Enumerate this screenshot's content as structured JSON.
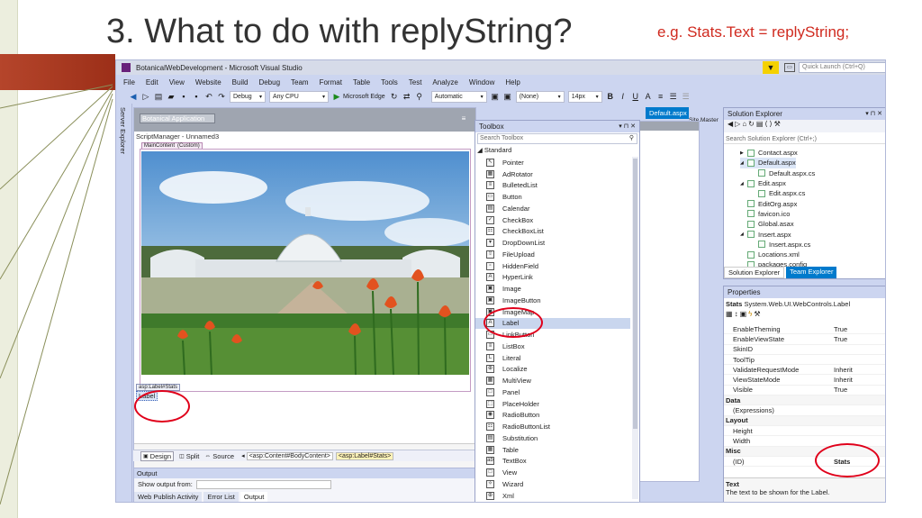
{
  "slide": {
    "title": "3. What to do with replyString?",
    "note": "e.g. Stats.Text = replyString;"
  },
  "window": {
    "title": "BotanicalWebDevelopment - Microsoft Visual Studio",
    "quick_launch_placeholder": "Quick Launch (Ctrl+Q)"
  },
  "menu": [
    "File",
    "Edit",
    "View",
    "Website",
    "Build",
    "Debug",
    "Team",
    "Format",
    "Table",
    "Tools",
    "Test",
    "Analyze",
    "Window",
    "Help"
  ],
  "toolbar": {
    "config": "Debug",
    "platform": "Any CPU",
    "browser": "Microsoft Edge",
    "style_mode": "Automatic",
    "style_name": "(None)",
    "font_size": "14px",
    "bold": "B",
    "italic": "I",
    "underline": "U"
  },
  "server_explorer": "Server Explorer",
  "designer": {
    "tab_active": "Default.aspx",
    "tab_master": "Site.Master",
    "header_text": "Botanical Application",
    "script_manager": "ScriptManager - Unnamed3",
    "main_content_tag": "MainContent",
    "main_content_custom": "(Custom)",
    "label_tag": "asp:Label#Stats",
    "label_text": "Label",
    "view_design": "Design",
    "view_split": "Split",
    "view_source": "Source",
    "breadcrumb_1": "<asp:Content#BodyContent>",
    "breadcrumb_2": "<asp:Label#Stats>"
  },
  "toolbox": {
    "title": "Toolbox",
    "search_placeholder": "Search Toolbox",
    "section": "Standard",
    "items": [
      {
        "label": "Pointer",
        "icon": "pointer-icon",
        "glyph": "↖"
      },
      {
        "label": "AdRotator",
        "icon": "adrotator-icon",
        "glyph": "▦"
      },
      {
        "label": "BulletedList",
        "icon": "bulleted-list-icon",
        "glyph": "≡"
      },
      {
        "label": "Button",
        "icon": "button-icon",
        "glyph": "▭"
      },
      {
        "label": "Calendar",
        "icon": "calendar-icon",
        "glyph": "▤"
      },
      {
        "label": "CheckBox",
        "icon": "checkbox-icon",
        "glyph": "✓"
      },
      {
        "label": "CheckBoxList",
        "icon": "checkbox-list-icon",
        "glyph": "☷"
      },
      {
        "label": "DropDownList",
        "icon": "dropdown-list-icon",
        "glyph": "▾"
      },
      {
        "label": "FileUpload",
        "icon": "file-upload-icon",
        "glyph": "⇧"
      },
      {
        "label": "HiddenField",
        "icon": "hidden-field-icon",
        "glyph": "▫"
      },
      {
        "label": "HyperLink",
        "icon": "hyperlink-icon",
        "glyph": "A"
      },
      {
        "label": "Image",
        "icon": "image-icon",
        "glyph": "▣"
      },
      {
        "label": "ImageButton",
        "icon": "image-button-icon",
        "glyph": "▣"
      },
      {
        "label": "ImageMap",
        "icon": "image-map-icon",
        "glyph": "▣"
      },
      {
        "label": "Label",
        "icon": "label-icon",
        "glyph": "A"
      },
      {
        "label": "LinkButton",
        "icon": "link-button-icon",
        "glyph": "▭"
      },
      {
        "label": "ListBox",
        "icon": "listbox-icon",
        "glyph": "≡"
      },
      {
        "label": "Literal",
        "icon": "literal-icon",
        "glyph": "L"
      },
      {
        "label": "Localize",
        "icon": "localize-icon",
        "glyph": "⊕"
      },
      {
        "label": "MultiView",
        "icon": "multiview-icon",
        "glyph": "▦"
      },
      {
        "label": "Panel",
        "icon": "panel-icon",
        "glyph": "□"
      },
      {
        "label": "PlaceHolder",
        "icon": "placeholder-icon",
        "glyph": "⬚"
      },
      {
        "label": "RadioButton",
        "icon": "radio-button-icon",
        "glyph": "◉"
      },
      {
        "label": "RadioButtonList",
        "icon": "radio-button-list-icon",
        "glyph": "☷"
      },
      {
        "label": "Substitution",
        "icon": "substitution-icon",
        "glyph": "▤"
      },
      {
        "label": "Table",
        "icon": "table-icon",
        "glyph": "▦"
      },
      {
        "label": "TextBox",
        "icon": "textbox-icon",
        "glyph": "ab"
      },
      {
        "label": "View",
        "icon": "view-icon",
        "glyph": "□"
      },
      {
        "label": "Wizard",
        "icon": "wizard-icon",
        "glyph": "✧"
      },
      {
        "label": "Xml",
        "icon": "xml-icon",
        "glyph": "⊕"
      }
    ]
  },
  "solution_explorer": {
    "title": "Solution Explorer",
    "search_placeholder": "Search Solution Explorer (Ctrl+;)",
    "items": [
      {
        "label": "Contact.aspx",
        "arrow": "▶",
        "indent": 0
      },
      {
        "label": "Default.aspx",
        "arrow": "◢",
        "indent": 0
      },
      {
        "label": "Default.aspx.cs",
        "arrow": "",
        "indent": 1
      },
      {
        "label": "Edit.aspx",
        "arrow": "◢",
        "indent": 0
      },
      {
        "label": "Edit.aspx.cs",
        "arrow": "",
        "indent": 1
      },
      {
        "label": "EditOrg.aspx",
        "arrow": "",
        "indent": 0
      },
      {
        "label": "favicon.ico",
        "arrow": "",
        "indent": 0
      },
      {
        "label": "Global.asax",
        "arrow": "",
        "indent": 0
      },
      {
        "label": "Insert.aspx",
        "arrow": "◢",
        "indent": 0
      },
      {
        "label": "Insert.aspx.cs",
        "arrow": "",
        "indent": 1
      },
      {
        "label": "Locations.xml",
        "arrow": "",
        "indent": 0
      },
      {
        "label": "packages.config",
        "arrow": "",
        "indent": 0
      }
    ],
    "tab_solution": "Solution Explorer",
    "tab_team": "Team Explorer"
  },
  "properties": {
    "title": "Properties",
    "object_name": "Stats",
    "object_type": "System.Web.UI.WebControls.Label",
    "rows": [
      {
        "k": "EnableTheming",
        "v": "True",
        "cat": false
      },
      {
        "k": "EnableViewState",
        "v": "True",
        "cat": false
      },
      {
        "k": "SkinID",
        "v": "",
        "cat": false
      },
      {
        "k": "ToolTip",
        "v": "",
        "cat": false
      },
      {
        "k": "ValidateRequestMode",
        "v": "Inherit",
        "cat": false
      },
      {
        "k": "ViewStateMode",
        "v": "Inherit",
        "cat": false
      },
      {
        "k": "Visible",
        "v": "True",
        "cat": false
      },
      {
        "k": "Data",
        "v": "",
        "cat": true
      },
      {
        "k": "(Expressions)",
        "v": "",
        "cat": false
      },
      {
        "k": "Layout",
        "v": "",
        "cat": true
      },
      {
        "k": "Height",
        "v": "",
        "cat": false
      },
      {
        "k": "Width",
        "v": "",
        "cat": false
      },
      {
        "k": "Misc",
        "v": "",
        "cat": true
      },
      {
        "k": "(ID)",
        "v": "Stats",
        "cat": false
      }
    ],
    "desc_title": "Text",
    "desc_text": "The text to be shown for the Label."
  },
  "output": {
    "title": "Output",
    "show_from": "Show output from:",
    "tab_publish": "Web Publish Activity",
    "tab_errors": "Error List",
    "tab_output": "Output"
  },
  "colors": {
    "accent_red": "#e0001a",
    "vs_bg": "#ccd5f0",
    "header_bar": "#3b5998"
  }
}
